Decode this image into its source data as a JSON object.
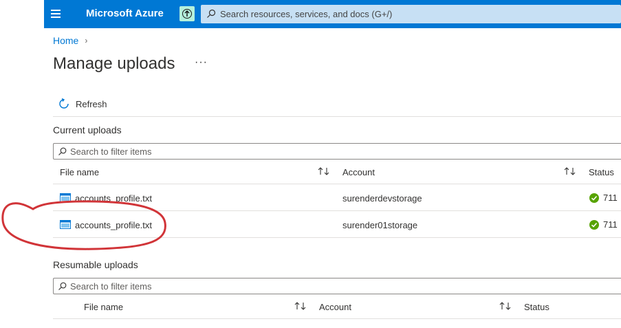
{
  "topbar": {
    "brand": "Microsoft Azure",
    "search_placeholder": "Search resources, services, and docs (G+/)"
  },
  "breadcrumb": {
    "home": "Home"
  },
  "page": {
    "title": "Manage uploads",
    "more": "···"
  },
  "toolbar": {
    "refresh_label": "Refresh"
  },
  "current": {
    "label": "Current uploads",
    "filter_placeholder": "Search to filter items",
    "columns": {
      "file": "File name",
      "account": "Account",
      "status": "Status"
    },
    "rows": [
      {
        "file": "accounts_profile.txt",
        "account": "surenderdevstorage",
        "status": "711"
      },
      {
        "file": "accounts_profile.txt",
        "account": "surender01storage",
        "status": "711"
      }
    ]
  },
  "resumable": {
    "label": "Resumable uploads",
    "filter_placeholder": "Search to filter items",
    "columns": {
      "file": "File name",
      "account": "Account",
      "status": "Status"
    }
  },
  "colors": {
    "accent": "#0078d4",
    "success": "#57a300",
    "annotation": "#d13438"
  }
}
